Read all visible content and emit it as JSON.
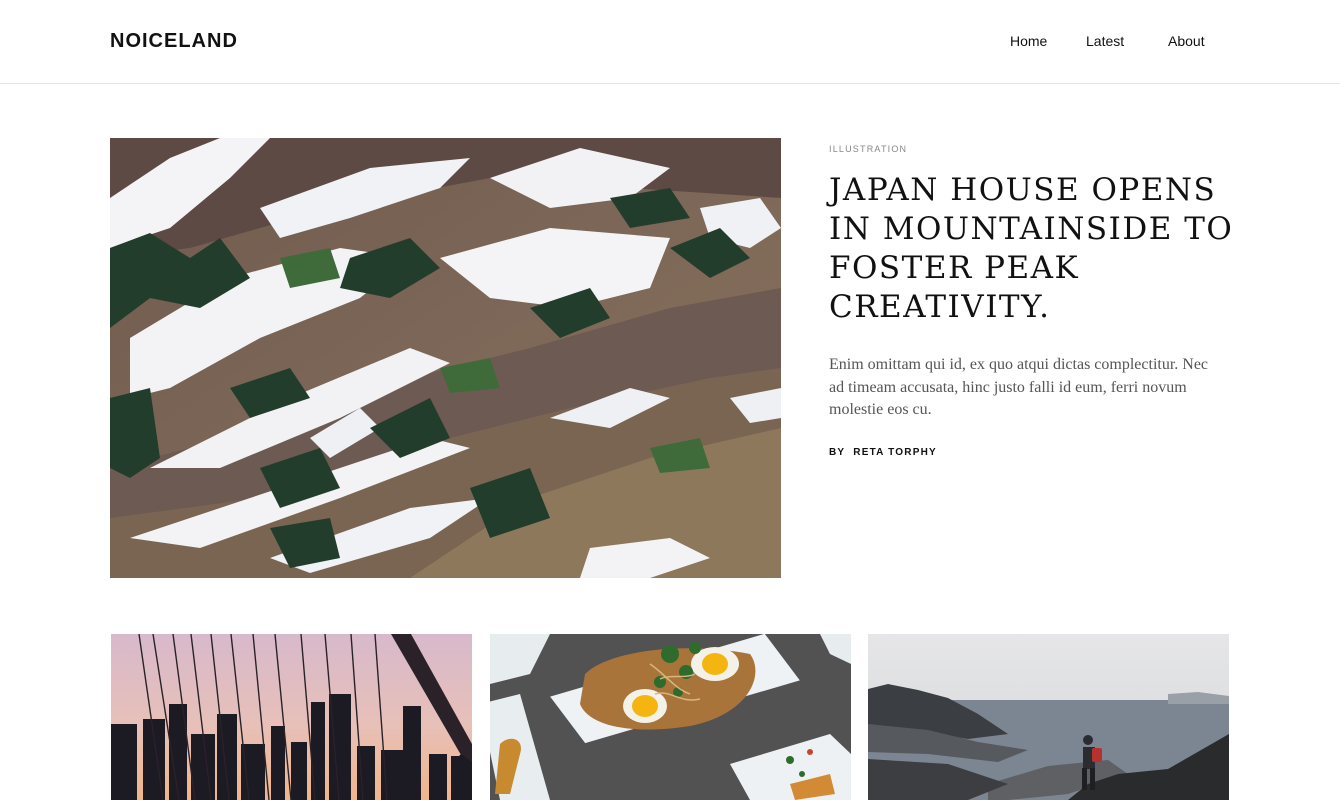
{
  "site": {
    "logo": "NOICELAND"
  },
  "nav": {
    "items": [
      {
        "label": "Home"
      },
      {
        "label": "Latest"
      },
      {
        "label": "About"
      }
    ]
  },
  "featured": {
    "category": "ILLUSTRATION",
    "title": "JAPAN HOUSE OPENS IN MOUNTAINSIDE TO FOSTER PEAK CREATIVITY.",
    "excerpt": "Enim omittam qui id, ex quo atqui dictas complectitur. Nec ad timeam accusata, hinc justo falli id eum, ferri novum molestie eos cu.",
    "byline_prefix": "BY",
    "author": "RETA TORPHY",
    "image_icon": "mountain-landscape-photo"
  },
  "cards": [
    {
      "image_icon": "city-bridge-photo"
    },
    {
      "image_icon": "food-plate-photo"
    },
    {
      "image_icon": "hiker-fjord-photo"
    }
  ],
  "colors": {
    "text": "#111111",
    "muted": "#888888",
    "excerpt": "#555555",
    "border": "#e6e6e6"
  }
}
